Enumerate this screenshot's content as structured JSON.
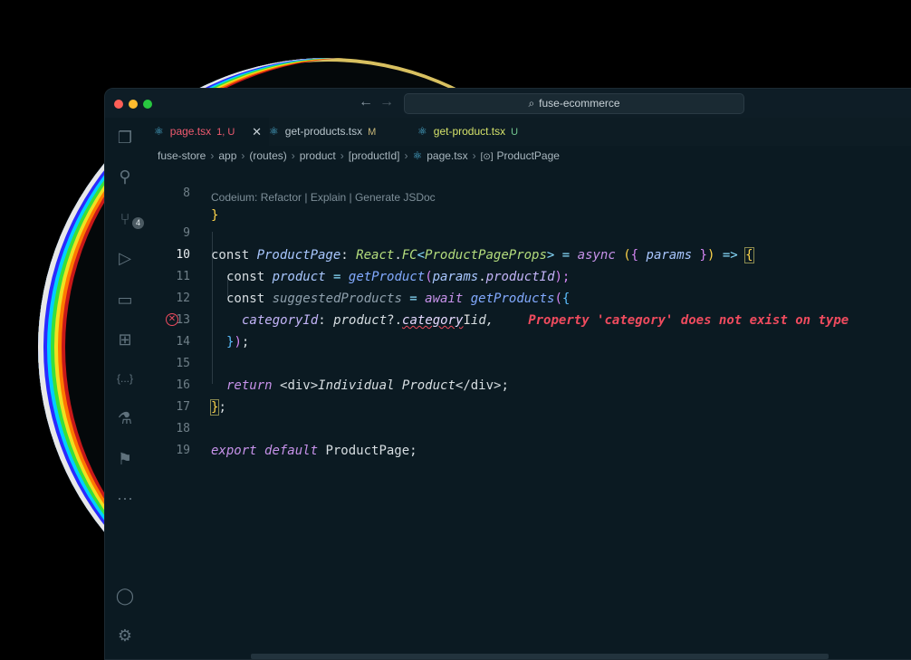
{
  "titlebar": {
    "search_text": "fuse-ecommerce"
  },
  "activity_bar": {
    "source_control_badge": "4",
    "extensions_label": "{...}"
  },
  "tabs": [
    {
      "label": "page.tsx",
      "status": "1, U"
    },
    {
      "label": "get-products.tsx",
      "status": "M"
    },
    {
      "label": "get-product.tsx",
      "status": "U"
    }
  ],
  "breadcrumb": [
    "fuse-store",
    "app",
    "(routes)",
    "product",
    "[productId]",
    "page.tsx",
    "ProductPage"
  ],
  "codelens": "Codeium: Refactor | Explain | Generate JSDoc",
  "line_numbers": [
    "8",
    "9",
    "10",
    "11",
    "12",
    "13",
    "14",
    "15",
    "16",
    "17",
    "18",
    "19"
  ],
  "code": {
    "l8": "}",
    "l9": {
      "kw_const": "const ",
      "name": "ProductPage",
      "colon": ": ",
      "type1": "React",
      "dot": ".",
      "type2": "FC",
      "lt": "<",
      "type3": "ProductPageProps",
      "gt": ">",
      "eq": " = ",
      "async": "async",
      "open_paren": " (",
      "open_brace": "{ ",
      "param": "params",
      "close_brace": " }",
      "close_paren": ")",
      "arrow": " => ",
      "body_brace": "{"
    },
    "l10": {
      "kw_const": "const ",
      "name": "product",
      "eq": " = ",
      "fn": "getProduct",
      "open": "(",
      "obj": "params",
      "dot": ".",
      "prop": "productId",
      "close": ");"
    },
    "l11": {
      "kw_const": "const ",
      "name": "suggestedProducts",
      "eq": " = ",
      "await": "await ",
      "fn": "getProducts",
      "open": "(",
      "brace": "{"
    },
    "l12": {
      "key": "categoryId",
      "colon": ": ",
      "obj": "product",
      "opt": "?.",
      "prop": "category",
      "cursor": "I",
      "rest": "id,",
      "error": "Property 'category' does not exist on type"
    },
    "l13": {
      "brace": "}",
      "paren": ")",
      "semi": ";"
    },
    "l15": {
      "kw_return": "return ",
      "jsx": "<div>",
      "text": "Individual Product",
      "jsx_close": "</div>",
      "semi": ";"
    },
    "l16": {
      "brace": "}",
      "semi": ";"
    },
    "l18": {
      "kw_export": "export ",
      "kw_default": "default ",
      "name": "ProductPage",
      "semi": ";"
    }
  }
}
